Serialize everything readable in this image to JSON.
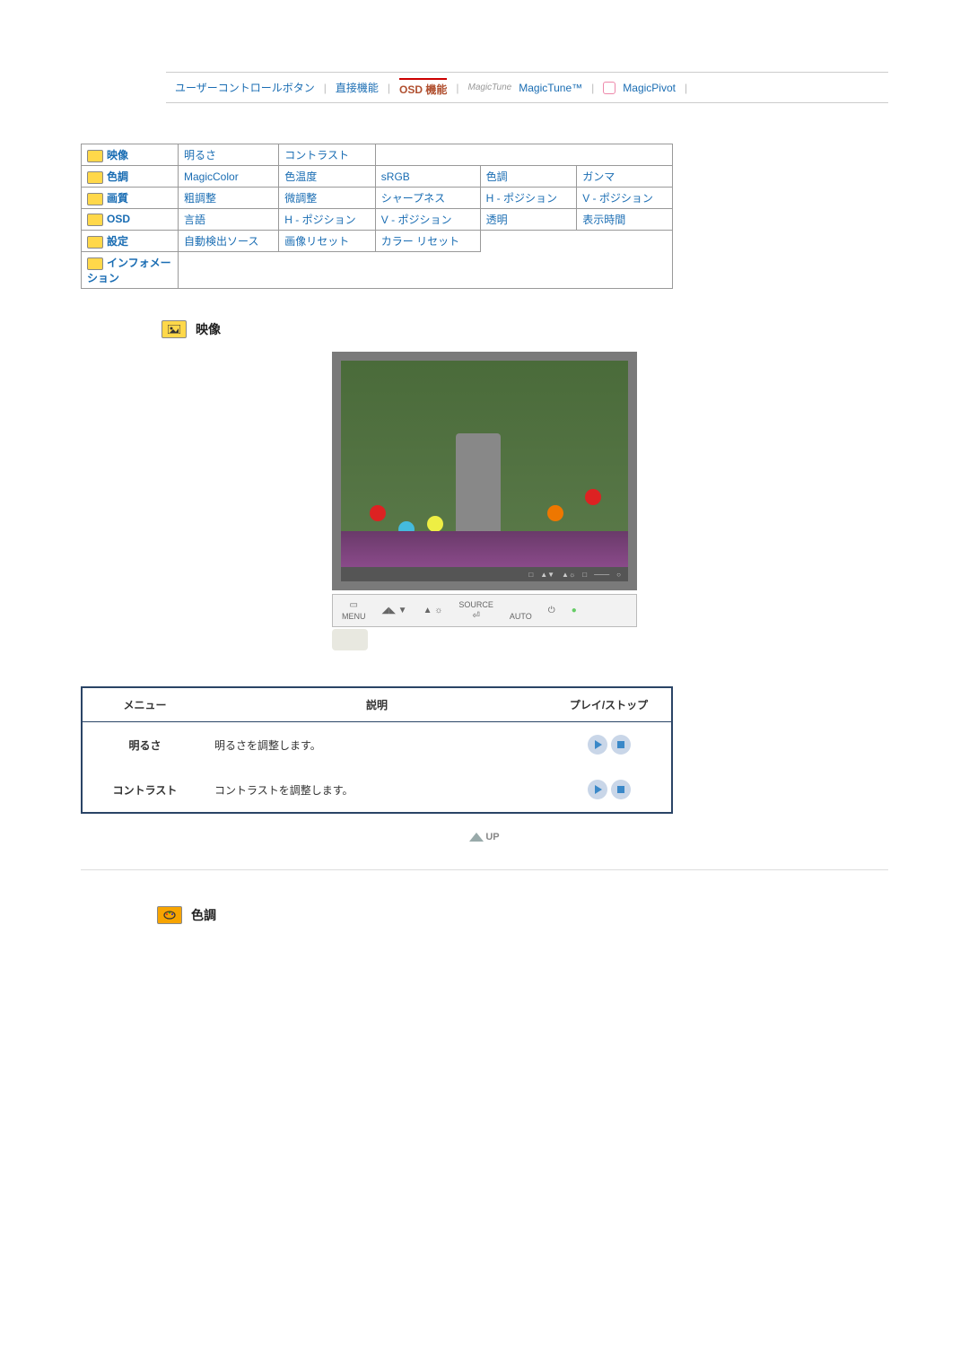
{
  "nav": {
    "user_control": "ユーザーコントロールボタン",
    "direct": "直接機能",
    "osd_active": "OSD 機能",
    "magictune": "MagicTune™",
    "magicpivot": "MagicPivot"
  },
  "osd_table": {
    "rows": [
      {
        "cat": "映像",
        "cells": [
          "明るさ",
          "コントラスト",
          "",
          "",
          ""
        ]
      },
      {
        "cat": "色調",
        "cells": [
          "MagicColor",
          "色温度",
          "sRGB",
          "色調",
          "ガンマ"
        ]
      },
      {
        "cat": "画質",
        "cells": [
          "粗調整",
          "微調整",
          "シャープネス",
          "H - ポジション",
          "V - ポジション"
        ]
      },
      {
        "cat": "OSD",
        "cells": [
          "言語",
          "H - ポジション",
          "V - ポジション",
          "透明",
          "表示時間"
        ]
      },
      {
        "cat": "設定",
        "cells": [
          "自動検出ソース",
          "画像リセット",
          "カラー リセット",
          "",
          ""
        ]
      },
      {
        "cat": "インフォメーション",
        "cells": [
          "",
          "",
          "",
          "",
          ""
        ]
      }
    ]
  },
  "section1": {
    "title": "映像"
  },
  "monitor_buttons": {
    "menu": "MENU",
    "source": "SOURCE",
    "auto": "AUTO"
  },
  "desc_table": {
    "headers": {
      "menu": "メニュー",
      "desc": "説明",
      "play": "プレイ/ストップ"
    },
    "rows": [
      {
        "menu": "明るさ",
        "desc": "明るさを調整します。"
      },
      {
        "menu": "コントラスト",
        "desc": "コントラストを調整します。"
      }
    ]
  },
  "up_label": "UP",
  "section2": {
    "title": "色調"
  }
}
